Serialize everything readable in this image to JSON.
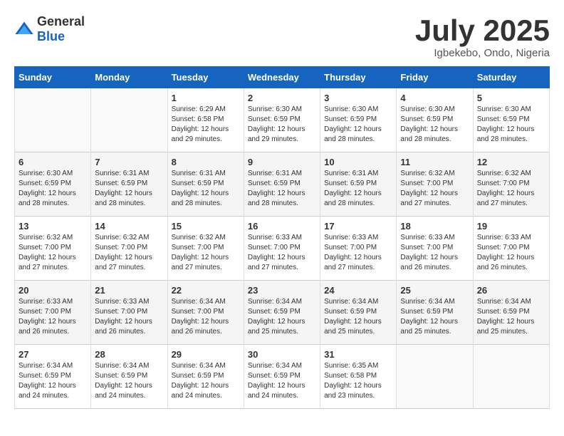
{
  "header": {
    "logo_general": "General",
    "logo_blue": "Blue",
    "month": "July 2025",
    "location": "Igbekebo, Ondo, Nigeria"
  },
  "weekdays": [
    "Sunday",
    "Monday",
    "Tuesday",
    "Wednesday",
    "Thursday",
    "Friday",
    "Saturday"
  ],
  "weeks": [
    [
      {
        "day": "",
        "sunrise": "",
        "sunset": "",
        "daylight": ""
      },
      {
        "day": "",
        "sunrise": "",
        "sunset": "",
        "daylight": ""
      },
      {
        "day": "1",
        "sunrise": "Sunrise: 6:29 AM",
        "sunset": "Sunset: 6:58 PM",
        "daylight": "Daylight: 12 hours and 29 minutes."
      },
      {
        "day": "2",
        "sunrise": "Sunrise: 6:30 AM",
        "sunset": "Sunset: 6:59 PM",
        "daylight": "Daylight: 12 hours and 29 minutes."
      },
      {
        "day": "3",
        "sunrise": "Sunrise: 6:30 AM",
        "sunset": "Sunset: 6:59 PM",
        "daylight": "Daylight: 12 hours and 28 minutes."
      },
      {
        "day": "4",
        "sunrise": "Sunrise: 6:30 AM",
        "sunset": "Sunset: 6:59 PM",
        "daylight": "Daylight: 12 hours and 28 minutes."
      },
      {
        "day": "5",
        "sunrise": "Sunrise: 6:30 AM",
        "sunset": "Sunset: 6:59 PM",
        "daylight": "Daylight: 12 hours and 28 minutes."
      }
    ],
    [
      {
        "day": "6",
        "sunrise": "Sunrise: 6:30 AM",
        "sunset": "Sunset: 6:59 PM",
        "daylight": "Daylight: 12 hours and 28 minutes."
      },
      {
        "day": "7",
        "sunrise": "Sunrise: 6:31 AM",
        "sunset": "Sunset: 6:59 PM",
        "daylight": "Daylight: 12 hours and 28 minutes."
      },
      {
        "day": "8",
        "sunrise": "Sunrise: 6:31 AM",
        "sunset": "Sunset: 6:59 PM",
        "daylight": "Daylight: 12 hours and 28 minutes."
      },
      {
        "day": "9",
        "sunrise": "Sunrise: 6:31 AM",
        "sunset": "Sunset: 6:59 PM",
        "daylight": "Daylight: 12 hours and 28 minutes."
      },
      {
        "day": "10",
        "sunrise": "Sunrise: 6:31 AM",
        "sunset": "Sunset: 6:59 PM",
        "daylight": "Daylight: 12 hours and 28 minutes."
      },
      {
        "day": "11",
        "sunrise": "Sunrise: 6:32 AM",
        "sunset": "Sunset: 7:00 PM",
        "daylight": "Daylight: 12 hours and 27 minutes."
      },
      {
        "day": "12",
        "sunrise": "Sunrise: 6:32 AM",
        "sunset": "Sunset: 7:00 PM",
        "daylight": "Daylight: 12 hours and 27 minutes."
      }
    ],
    [
      {
        "day": "13",
        "sunrise": "Sunrise: 6:32 AM",
        "sunset": "Sunset: 7:00 PM",
        "daylight": "Daylight: 12 hours and 27 minutes."
      },
      {
        "day": "14",
        "sunrise": "Sunrise: 6:32 AM",
        "sunset": "Sunset: 7:00 PM",
        "daylight": "Daylight: 12 hours and 27 minutes."
      },
      {
        "day": "15",
        "sunrise": "Sunrise: 6:32 AM",
        "sunset": "Sunset: 7:00 PM",
        "daylight": "Daylight: 12 hours and 27 minutes."
      },
      {
        "day": "16",
        "sunrise": "Sunrise: 6:33 AM",
        "sunset": "Sunset: 7:00 PM",
        "daylight": "Daylight: 12 hours and 27 minutes."
      },
      {
        "day": "17",
        "sunrise": "Sunrise: 6:33 AM",
        "sunset": "Sunset: 7:00 PM",
        "daylight": "Daylight: 12 hours and 27 minutes."
      },
      {
        "day": "18",
        "sunrise": "Sunrise: 6:33 AM",
        "sunset": "Sunset: 7:00 PM",
        "daylight": "Daylight: 12 hours and 26 minutes."
      },
      {
        "day": "19",
        "sunrise": "Sunrise: 6:33 AM",
        "sunset": "Sunset: 7:00 PM",
        "daylight": "Daylight: 12 hours and 26 minutes."
      }
    ],
    [
      {
        "day": "20",
        "sunrise": "Sunrise: 6:33 AM",
        "sunset": "Sunset: 7:00 PM",
        "daylight": "Daylight: 12 hours and 26 minutes."
      },
      {
        "day": "21",
        "sunrise": "Sunrise: 6:33 AM",
        "sunset": "Sunset: 7:00 PM",
        "daylight": "Daylight: 12 hours and 26 minutes."
      },
      {
        "day": "22",
        "sunrise": "Sunrise: 6:34 AM",
        "sunset": "Sunset: 7:00 PM",
        "daylight": "Daylight: 12 hours and 26 minutes."
      },
      {
        "day": "23",
        "sunrise": "Sunrise: 6:34 AM",
        "sunset": "Sunset: 6:59 PM",
        "daylight": "Daylight: 12 hours and 25 minutes."
      },
      {
        "day": "24",
        "sunrise": "Sunrise: 6:34 AM",
        "sunset": "Sunset: 6:59 PM",
        "daylight": "Daylight: 12 hours and 25 minutes."
      },
      {
        "day": "25",
        "sunrise": "Sunrise: 6:34 AM",
        "sunset": "Sunset: 6:59 PM",
        "daylight": "Daylight: 12 hours and 25 minutes."
      },
      {
        "day": "26",
        "sunrise": "Sunrise: 6:34 AM",
        "sunset": "Sunset: 6:59 PM",
        "daylight": "Daylight: 12 hours and 25 minutes."
      }
    ],
    [
      {
        "day": "27",
        "sunrise": "Sunrise: 6:34 AM",
        "sunset": "Sunset: 6:59 PM",
        "daylight": "Daylight: 12 hours and 24 minutes."
      },
      {
        "day": "28",
        "sunrise": "Sunrise: 6:34 AM",
        "sunset": "Sunset: 6:59 PM",
        "daylight": "Daylight: 12 hours and 24 minutes."
      },
      {
        "day": "29",
        "sunrise": "Sunrise: 6:34 AM",
        "sunset": "Sunset: 6:59 PM",
        "daylight": "Daylight: 12 hours and 24 minutes."
      },
      {
        "day": "30",
        "sunrise": "Sunrise: 6:34 AM",
        "sunset": "Sunset: 6:59 PM",
        "daylight": "Daylight: 12 hours and 24 minutes."
      },
      {
        "day": "31",
        "sunrise": "Sunrise: 6:35 AM",
        "sunset": "Sunset: 6:58 PM",
        "daylight": "Daylight: 12 hours and 23 minutes."
      },
      {
        "day": "",
        "sunrise": "",
        "sunset": "",
        "daylight": ""
      },
      {
        "day": "",
        "sunrise": "",
        "sunset": "",
        "daylight": ""
      }
    ]
  ]
}
